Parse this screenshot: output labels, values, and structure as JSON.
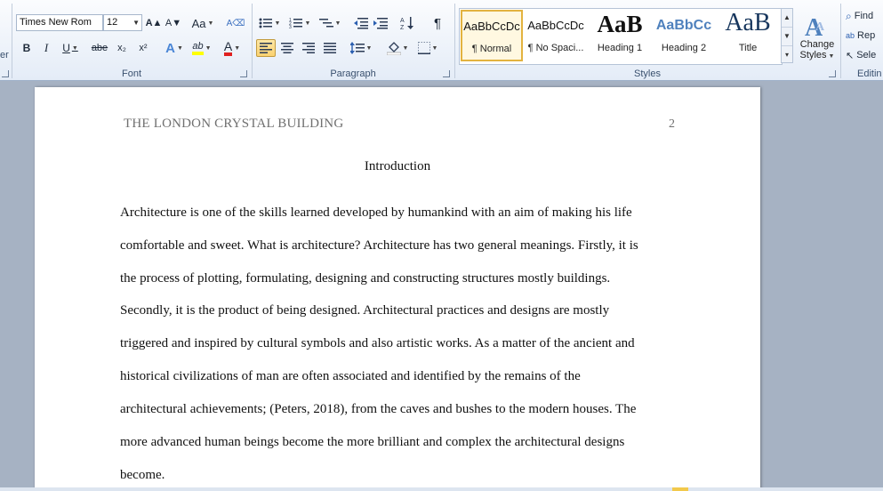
{
  "ribbon": {
    "clipboard_partial": "er",
    "font": {
      "label": "Font",
      "family_value": "Times New Rom",
      "size_value": "12",
      "grow_icon": "A▲",
      "shrink_icon": "A▼",
      "change_case_icon": "Aa",
      "clear_format_icon": "A⌫",
      "bold": "B",
      "italic": "I",
      "underline": "U",
      "strike": "abe",
      "subscript": "x₂",
      "superscript": "x²",
      "text_effects_icon": "A",
      "highlight_icon": "ab",
      "font_color_icon": "A",
      "highlight_color": "#ffff00",
      "font_color": "#e02020"
    },
    "paragraph": {
      "label": "Paragraph",
      "pilcrow": "¶"
    },
    "styles": {
      "label": "Styles",
      "items": [
        {
          "sample": "AaBbCcDc",
          "name": "¶ Normal"
        },
        {
          "sample": "AaBbCcDc",
          "name": "¶ No Spaci..."
        },
        {
          "sample": "AaB",
          "name": "Heading 1"
        },
        {
          "sample": "AaBbCc",
          "name": "Heading 2"
        },
        {
          "sample": "AaB",
          "name": "Title"
        }
      ],
      "change_styles_line1": "Change",
      "change_styles_line2": "Styles"
    },
    "editing": {
      "label": "Editin",
      "find": "Find",
      "replace": "Rep",
      "select": "Sele"
    }
  },
  "document": {
    "header_title": "THE LONDON CRYSTAL BUILDING",
    "page_number": "2",
    "heading": "Introduction",
    "lines": [
      "Architecture is one of the skills learned developed by humankind with an aim of making his life",
      "comfortable and sweet. What is architecture? Architecture has two general meanings.  Firstly, it is",
      "the process of plotting, formulating, designing and constructing structures mostly buildings.",
      "Secondly, it is the product of being designed. Architectural practices and designs are mostly",
      "triggered and inspired by cultural symbols and also artistic works. As a matter of the ancient and",
      "historical  civilizations  of man are often associated and identified by the remains  of the",
      "architectural achievements; (Peters, 2018), from the caves and bushes to the modern houses. The",
      "more advanced human beings become the more brilliant  and complex the architectural designs",
      "become."
    ]
  }
}
